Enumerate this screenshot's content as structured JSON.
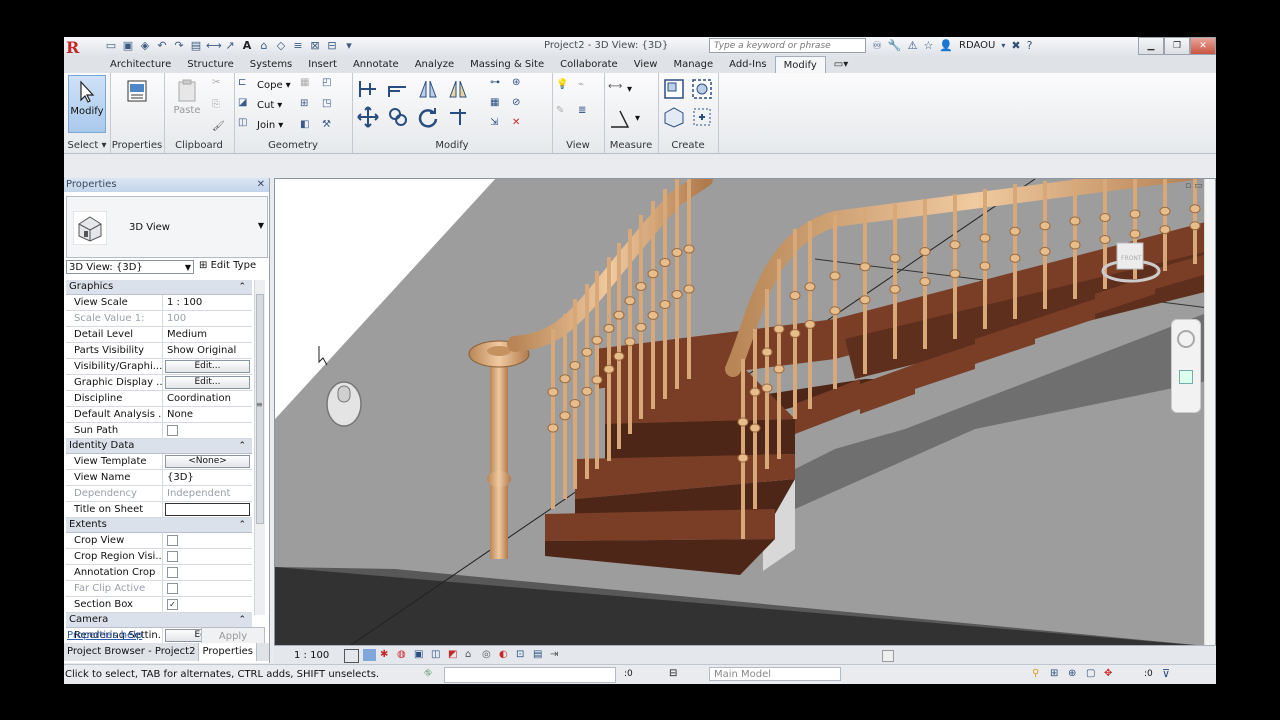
{
  "titlebar": {
    "logo": "R",
    "title": "Project2 - 3D View: {3D}",
    "search_placeholder": "Type a keyword or phrase",
    "user": "RDAOU"
  },
  "tabs": [
    "Architecture",
    "Structure",
    "Systems",
    "Insert",
    "Annotate",
    "Analyze",
    "Massing & Site",
    "Collaborate",
    "View",
    "Manage",
    "Add-Ins",
    "Modify"
  ],
  "active_tab": "Modify",
  "ribbon": {
    "modify_label": "Modify",
    "select_label": "Select",
    "properties_label": "Properties",
    "paste_label": "Paste",
    "clipboard_label": "Clipboard",
    "cope_label": "Cope",
    "cut_label": "Cut",
    "join_label": "Join",
    "geometry_label": "Geometry",
    "modify_panel_label": "Modify",
    "view_label": "View",
    "measure_label": "Measure",
    "create_label": "Create"
  },
  "properties": {
    "title": "Properties",
    "type_name": "3D View",
    "view_dropdown": "3D View: {3D}",
    "edit_type": "Edit Type",
    "groups": [
      {
        "name": "Graphics",
        "rows": [
          {
            "k": "View Scale",
            "v": "1 : 100"
          },
          {
            "k": "Scale Value    1:",
            "v": "100",
            "dim": true
          },
          {
            "k": "Detail Level",
            "v": "Medium"
          },
          {
            "k": "Parts Visibility",
            "v": "Show Original"
          },
          {
            "k": "Visibility/Graphi...",
            "btn": "Edit..."
          },
          {
            "k": "Graphic Display ...",
            "btn": "Edit..."
          },
          {
            "k": "Discipline",
            "v": "Coordination"
          },
          {
            "k": "Default Analysis ...",
            "v": "None"
          },
          {
            "k": "Sun Path",
            "chk": false
          }
        ]
      },
      {
        "name": "Identity Data",
        "rows": [
          {
            "k": "View Template",
            "btn": "<None>"
          },
          {
            "k": "View Name",
            "v": "{3D}"
          },
          {
            "k": "Dependency",
            "v": "Independent",
            "dim": true
          },
          {
            "k": "Title on Sheet",
            "input": true
          }
        ]
      },
      {
        "name": "Extents",
        "rows": [
          {
            "k": "Crop View",
            "chk": false
          },
          {
            "k": "Crop Region Visi...",
            "chk": false
          },
          {
            "k": "Annotation Crop",
            "chk": false
          },
          {
            "k": "Far Clip Active",
            "chk": false,
            "dim": true
          },
          {
            "k": "Section Box",
            "chk": true
          }
        ]
      },
      {
        "name": "Camera",
        "rows": [
          {
            "k": "Rendering Settin...",
            "btn": "Edit..."
          }
        ]
      }
    ],
    "help": "Properties help",
    "apply": "Apply",
    "tab_project_browser": "Project Browser - Project2",
    "tab_properties": "Properties"
  },
  "viewbar": {
    "scale": "1 : 100"
  },
  "status": {
    "message": "Click to select, TAB for alternates, CTRL adds, SHIFT unselects.",
    "zero": ":0",
    "model": "Main Model",
    "zero2": ":0"
  },
  "viewcube": {
    "face": "FRONT"
  },
  "colors": {
    "wood": "#d8a878",
    "tread": "#7a3e26",
    "riser": "#4e2618",
    "floor": "#9b9b9b",
    "accent": "#a9c9ec"
  }
}
